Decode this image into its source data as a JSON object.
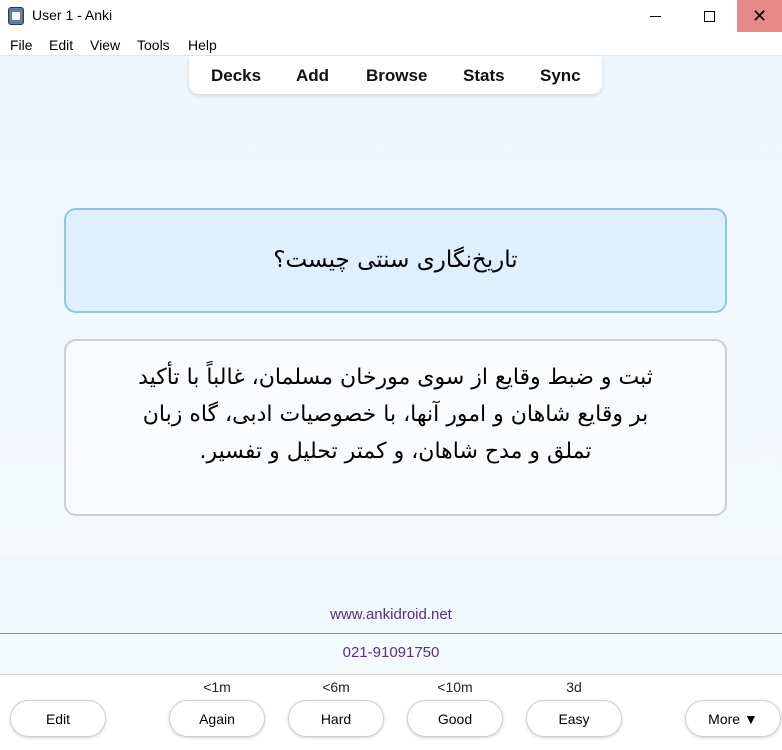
{
  "window": {
    "title": "User 1 - Anki"
  },
  "menu": {
    "file": "File",
    "edit": "Edit",
    "view": "View",
    "tools": "Tools",
    "help": "Help"
  },
  "toolbar": {
    "decks": "Decks",
    "add": "Add",
    "browse": "Browse",
    "stats": "Stats",
    "sync": "Sync"
  },
  "card": {
    "question": "تاریخ‌نگاری سنتی چیست؟",
    "answer_lines": [
      "ثبت و ضبط وقایع از سوی مورخان مسلمان، غالباً با تأکید",
      "بر وقایع شاهان و امور آنها، با خصوصیات ادبی، گاه زبان",
      "تملق و مدح شاهان، و کمتر تحلیل و تفسیر."
    ]
  },
  "footer": {
    "website": "www.ankidroid.net",
    "phone": "021-91091750"
  },
  "answer_bar": {
    "edit_label": "Edit",
    "again_label": "Again",
    "again_interval": "<1m",
    "hard_label": "Hard",
    "hard_interval": "<6m",
    "good_label": "Good",
    "good_interval": "<10m",
    "easy_label": "Easy",
    "easy_interval": "3d",
    "more_label": "More ▼"
  },
  "icons": {
    "app": "anki-app-icon",
    "minimize": "minimize-icon",
    "maximize": "maximize-icon",
    "close": "close-icon"
  },
  "colors": {
    "close_button": "#e68888",
    "question_bg": "#dff0fc",
    "question_border": "#8cc6e8",
    "link": "#5a2d82"
  }
}
